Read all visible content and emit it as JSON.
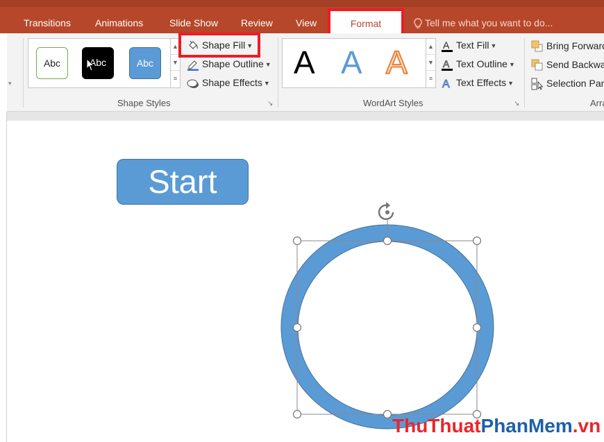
{
  "ribbon_tabs": {
    "transitions": "Transitions",
    "animations": "Animations",
    "slide_show": "Slide Show",
    "review": "Review",
    "view": "View",
    "format": "Format",
    "tell_me": "Tell me what you want to do..."
  },
  "shape_styles": {
    "swatch1": "Abc",
    "swatch2": "Abc",
    "swatch3": "Abc",
    "shape_fill": "Shape Fill",
    "shape_outline": "Shape Outline",
    "shape_effects": "Shape Effects",
    "group_label": "Shape Styles"
  },
  "wordart_styles": {
    "letter1": "A",
    "letter2": "A",
    "letter3": "A",
    "text_fill": "Text Fill",
    "text_outline": "Text Outline",
    "text_effects": "Text Effects",
    "group_label": "WordArt Styles"
  },
  "arrange": {
    "bring_forward": "Bring Forward",
    "send_backward": "Send Backward",
    "selection_pane": "Selection Pane",
    "group_label": "Arrange"
  },
  "slide": {
    "start_label": "Start"
  },
  "watermark": {
    "part1": "ThuThuat",
    "part2": "PhanMem",
    "part3": ".vn"
  },
  "colors": {
    "tab_bar": "#b7472a",
    "highlight": "#ee1c25",
    "shape_blue": "#5b9bd5",
    "wordart_orange": "#ed7d31"
  }
}
